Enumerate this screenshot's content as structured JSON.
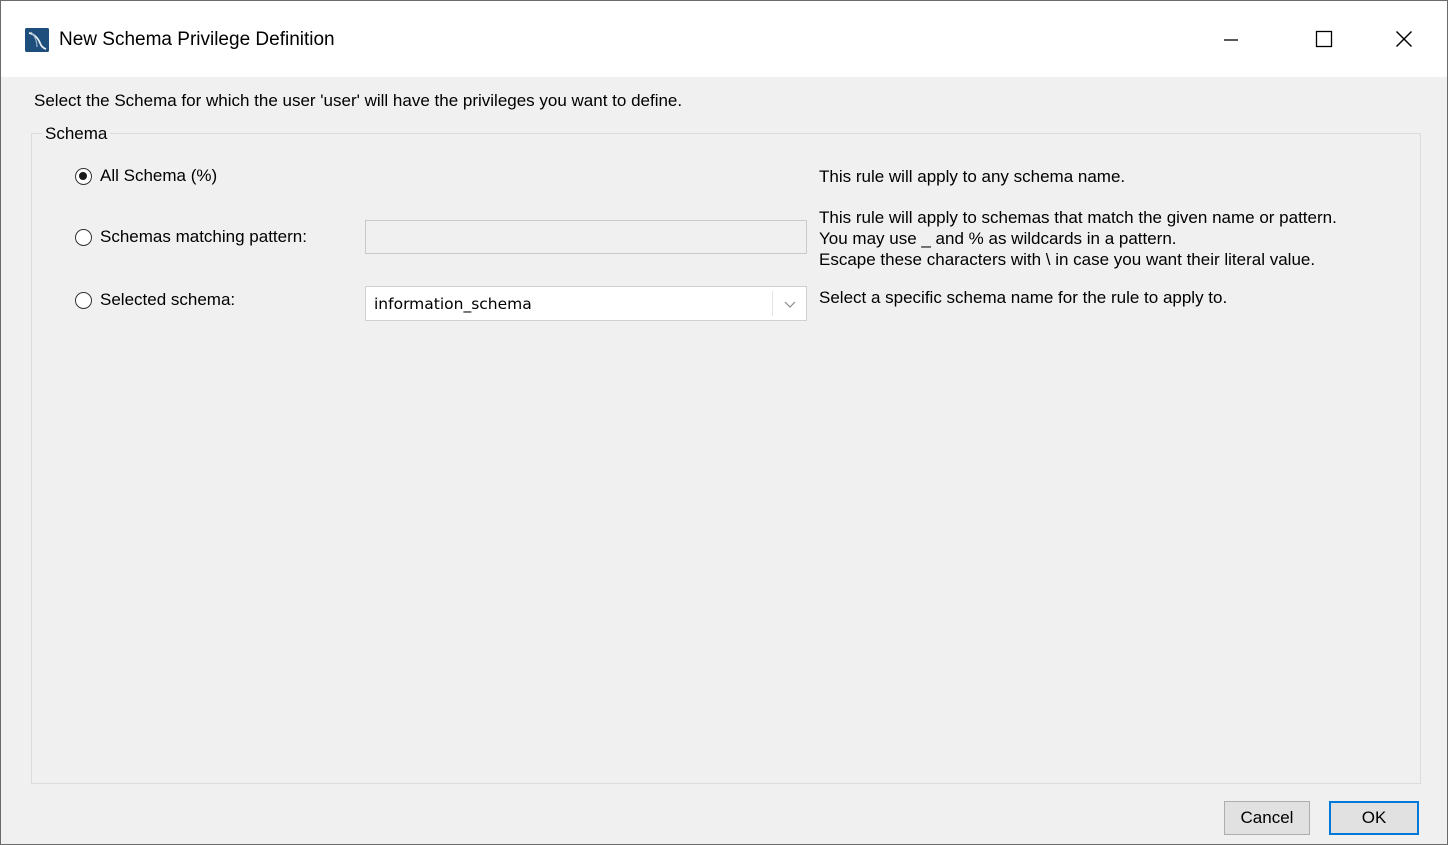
{
  "window": {
    "title": "New Schema Privilege Definition",
    "icon": "mysql-workbench-icon",
    "controls": {
      "minimize": "minimize-icon",
      "maximize": "maximize-icon",
      "close": "close-icon"
    }
  },
  "instruction": "Select the Schema for which the user 'user' will have the privileges you want to define.",
  "schema_group": {
    "legend": "Schema",
    "options": [
      {
        "label": "All Schema (%)",
        "checked": true,
        "description": [
          "This rule will apply to any schema name."
        ]
      },
      {
        "label": "Schemas matching pattern:",
        "checked": false,
        "input_value": "",
        "description": [
          "This rule will apply to schemas that match the given name or pattern.",
          "You may use _ and % as wildcards in a pattern.",
          "Escape these characters with \\ in case you want their literal value."
        ]
      },
      {
        "label": "Selected schema:",
        "checked": false,
        "selected_value": "information_schema",
        "description": [
          "Select a specific schema name for the rule to apply to."
        ]
      }
    ]
  },
  "buttons": {
    "cancel": "Cancel",
    "ok": "OK"
  },
  "colors": {
    "window_bg": "#f0f0f0",
    "titlebar_bg": "#ffffff",
    "accent": "#0078d7",
    "app_icon": "#1d4e7c"
  }
}
